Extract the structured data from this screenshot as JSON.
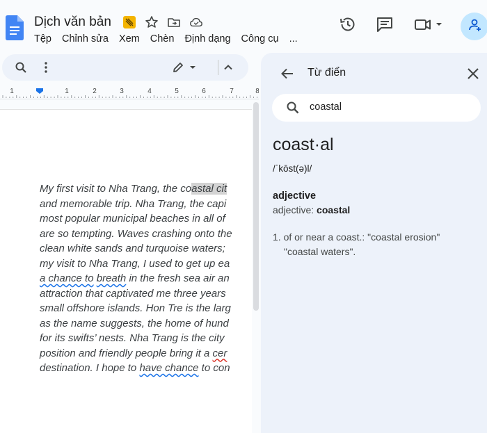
{
  "doc": {
    "title": "Dịch văn bản",
    "menu": [
      "Tệp",
      "Chỉnh sửa",
      "Xem",
      "Chèn",
      "Định dạng",
      "Công cụ",
      "..."
    ]
  },
  "header_icons": [
    "doc-logo-icon",
    "tag-icon",
    "star-icon",
    "move-folder-icon",
    "cloud-saved-icon",
    "history-icon",
    "comment-icon",
    "video-call-icon",
    "add-person-icon"
  ],
  "toolbar_icons": [
    "search-icon",
    "more-vert-icon",
    "pencil-icon",
    "caret-down-icon",
    "chevron-up-icon"
  ],
  "ruler": {
    "numbers": [
      "1",
      "1",
      "2",
      "3",
      "4",
      "5",
      "6",
      "7",
      "8"
    ]
  },
  "body": {
    "lines": [
      {
        "parts": [
          {
            "t": "My first visit to Nha Trang, the co"
          },
          {
            "t": "astal",
            "s": "hl"
          },
          {
            "t": " cit",
            "s": "hl"
          }
        ]
      },
      {
        "parts": [
          {
            "t": "and memorable trip. Nha Trang, the capi"
          }
        ]
      },
      {
        "parts": [
          {
            "t": "most popular municipal beaches in all of"
          }
        ]
      },
      {
        "parts": [
          {
            "t": "are so tempting. Waves crashing onto the"
          }
        ]
      },
      {
        "parts": [
          {
            "t": "clean white sands and turquoise waters;"
          }
        ]
      },
      {
        "parts": [
          {
            "t": "my visit to Nha Trang, I used to get up ea"
          }
        ]
      },
      {
        "parts": [
          {
            "t": "a chance to",
            "s": "sq"
          },
          {
            "t": " "
          },
          {
            "t": "breath",
            "s": "sq"
          },
          {
            "t": " in the fresh sea air an"
          }
        ]
      },
      {
        "parts": [
          {
            "t": "attraction that captivated me three years"
          }
        ]
      },
      {
        "parts": [
          {
            "t": "small offshore islands. Hon Tre is the larg"
          }
        ]
      },
      {
        "parts": [
          {
            "t": "as the name suggests, the home of hund"
          }
        ]
      },
      {
        "parts": [
          {
            "t": "for its swifts’ nests. Nha Trang is the city"
          }
        ]
      },
      {
        "parts": [
          {
            "t": "position and friendly people bring it a "
          },
          {
            "t": "cer",
            "s": "sqr"
          }
        ]
      },
      {
        "parts": [
          {
            "t": "destination. I hope to "
          },
          {
            "t": "have chance",
            "s": "sq"
          },
          {
            "t": " to con"
          }
        ]
      }
    ]
  },
  "dictionary": {
    "title": "Từ điển",
    "search_value": "coastal",
    "headword": "coast·al",
    "pronunciation": "/ˈkōst(ə)l/",
    "part_of_speech": "adjective",
    "form_label": "adjective:",
    "form_word": "coastal",
    "definition": "1. of or near a coast.: \"coastal erosion\"",
    "example": "\"coastal waters\"."
  },
  "colors": {
    "accent": "#1a73e8",
    "panel_bg": "#edf2fa",
    "avatar_bg": "#c2e7ff",
    "highlight": "#d3d3d3"
  }
}
